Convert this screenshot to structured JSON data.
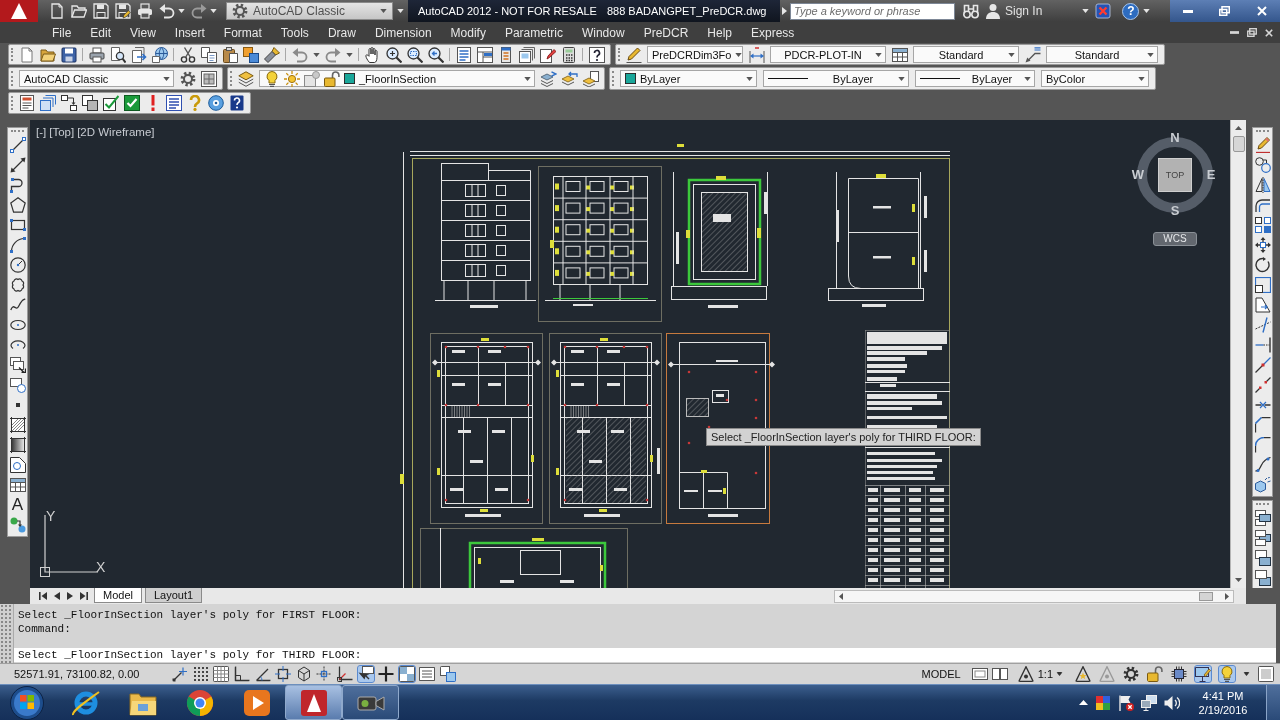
{
  "title_bar": {
    "workspace": "AutoCAD Classic",
    "product": "AutoCAD 2012 - NOT FOR RESALE",
    "file_name": "888 BADANGPET_PreDCR.dwg",
    "search": {
      "placeholder": "Type a keyword or phrase"
    },
    "sign_in": "Sign In",
    "help": "?"
  },
  "menu_bar": [
    "File",
    "Edit",
    "View",
    "Insert",
    "Format",
    "Tools",
    "Draw",
    "Dimension",
    "Modify",
    "Parametric",
    "Window",
    "PreDCR",
    "Help",
    "Express"
  ],
  "styles_toolbar": {
    "text_style": "PreDCRDim3Fo",
    "dimension_style": "PDCR-PLOT-IN",
    "table_style": "Standard",
    "multileader_style": "Standard"
  },
  "workspaces_toolbar": {
    "workspace": "AutoCAD Classic"
  },
  "layers_toolbar": {
    "layer": "_FloorInSection"
  },
  "properties_toolbar": {
    "color_setting": "ByLayer",
    "linetype": "ByLayer",
    "lineweight": "ByLayer",
    "plot_style": "ByColor"
  },
  "draw_toolbar": {
    "text_tool": "A"
  },
  "viewport": {
    "controls": [
      "[-]",
      "[Top]",
      "[2D Wireframe]"
    ],
    "viewcube": {
      "north": "N",
      "west": "W",
      "face": "TOP",
      "east": "E",
      "south": "S",
      "ucs_menu": "WCS"
    },
    "ucs_icon": {
      "y_axis": "Y",
      "x_axis": "X"
    },
    "tooltip": "Select _FloorInSection layer's poly for THIRD FLOOR:"
  },
  "layout_tabs": [
    {
      "label": "Model",
      "selected": true
    },
    {
      "label": "Layout1",
      "selected": false
    }
  ],
  "command_window": {
    "history": [
      "Select _FloorInSection layer's poly for FIRST FLOOR:",
      "Command:"
    ],
    "prompt": "Select _FloorInSection layer's poly for THIRD FLOOR:"
  },
  "status_bar": {
    "coordinates": "52571.91, 73100.82, 0.00",
    "drafting_toggles": [
      {
        "on": false
      },
      {
        "on": false
      },
      {
        "on": false
      },
      {
        "on": false
      },
      {
        "on": false
      },
      {
        "on": false
      },
      {
        "on": false
      },
      {
        "on": false
      },
      {
        "on": false
      },
      {
        "on": true
      },
      {
        "on": false
      },
      {
        "on": true
      },
      {
        "on": false
      },
      {
        "on": false
      }
    ],
    "space": "MODEL",
    "annotation_scale": "1:1",
    "tools": [
      {
        "on": false
      },
      {
        "on": false
      },
      {
        "on": false
      },
      {
        "on": false
      },
      {
        "on": false
      },
      {
        "on": true
      },
      {
        "on": true
      },
      {
        "on": false
      }
    ]
  },
  "taskbar": {
    "apps": [
      {
        "running": false,
        "selected": false
      },
      {
        "running": false,
        "selected": false
      },
      {
        "running": false,
        "selected": false
      },
      {
        "running": false,
        "selected": false
      },
      {
        "running": true,
        "selected": true
      },
      {
        "running": true,
        "selected": false
      }
    ],
    "time": "4:41 PM",
    "date": "2/19/2016"
  }
}
